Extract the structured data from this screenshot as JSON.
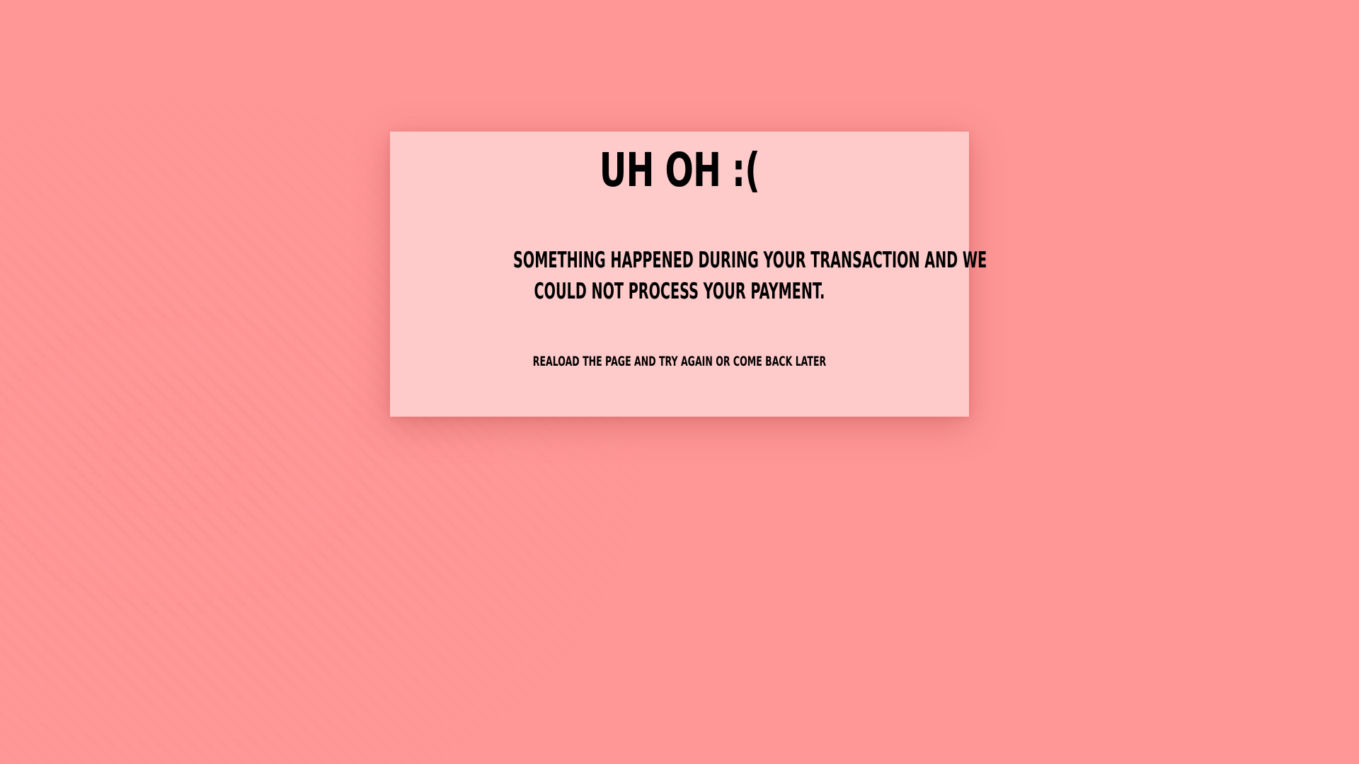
{
  "page": {
    "background_color": "#ff9797",
    "card_color": "#ffcaca",
    "text_color": "#000000"
  },
  "error": {
    "title": "UH OH :(",
    "message_line_1": "SOMETHING HAPPENED DURING YOUR TRANSACTION AND WE",
    "message_line_2": "COULD NOT PROCESS YOUR PAYMENT.",
    "hint": "REALOAD THE PAGE AND TRY AGAIN OR COME BACK LATER"
  }
}
